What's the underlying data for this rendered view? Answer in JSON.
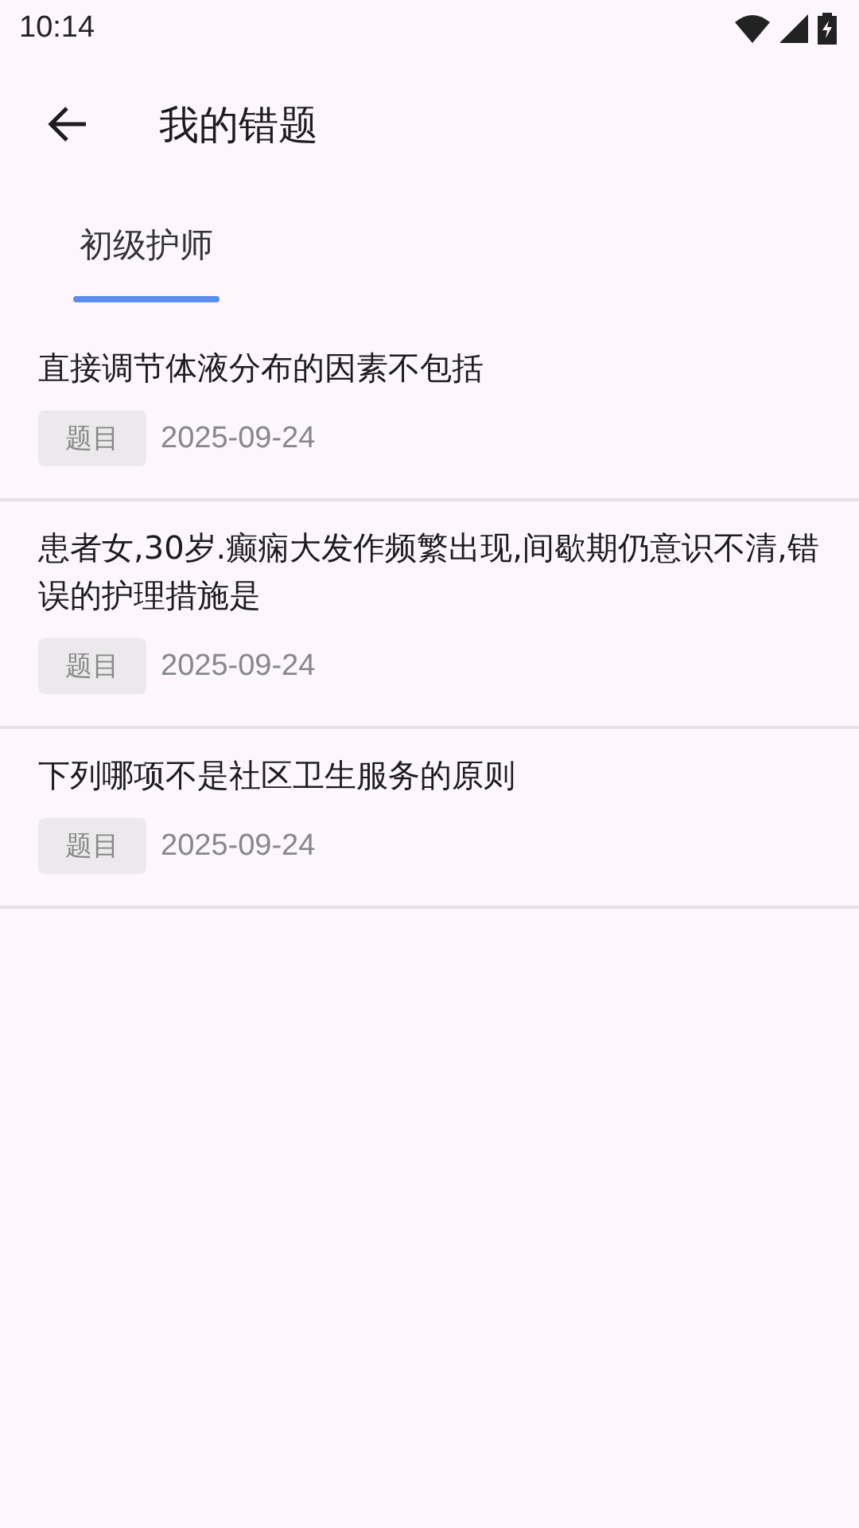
{
  "status_bar": {
    "time": "10:14"
  },
  "top_bar": {
    "title": "我的错题"
  },
  "tabs": [
    {
      "label": "初级护师",
      "selected": true
    }
  ],
  "items": [
    {
      "question": "直接调节体液分布的因素不包括",
      "tag": "题目",
      "date": "2025-09-24"
    },
    {
      "question": "患者女,30岁.癫痫大发作频繁出现,间歇期仍意识不清,错误的护理措施是",
      "tag": "题目",
      "date": "2025-09-24"
    },
    {
      "question": "下列哪项不是社区卫生服务的原则",
      "tag": "题目",
      "date": "2025-09-24"
    }
  ]
}
